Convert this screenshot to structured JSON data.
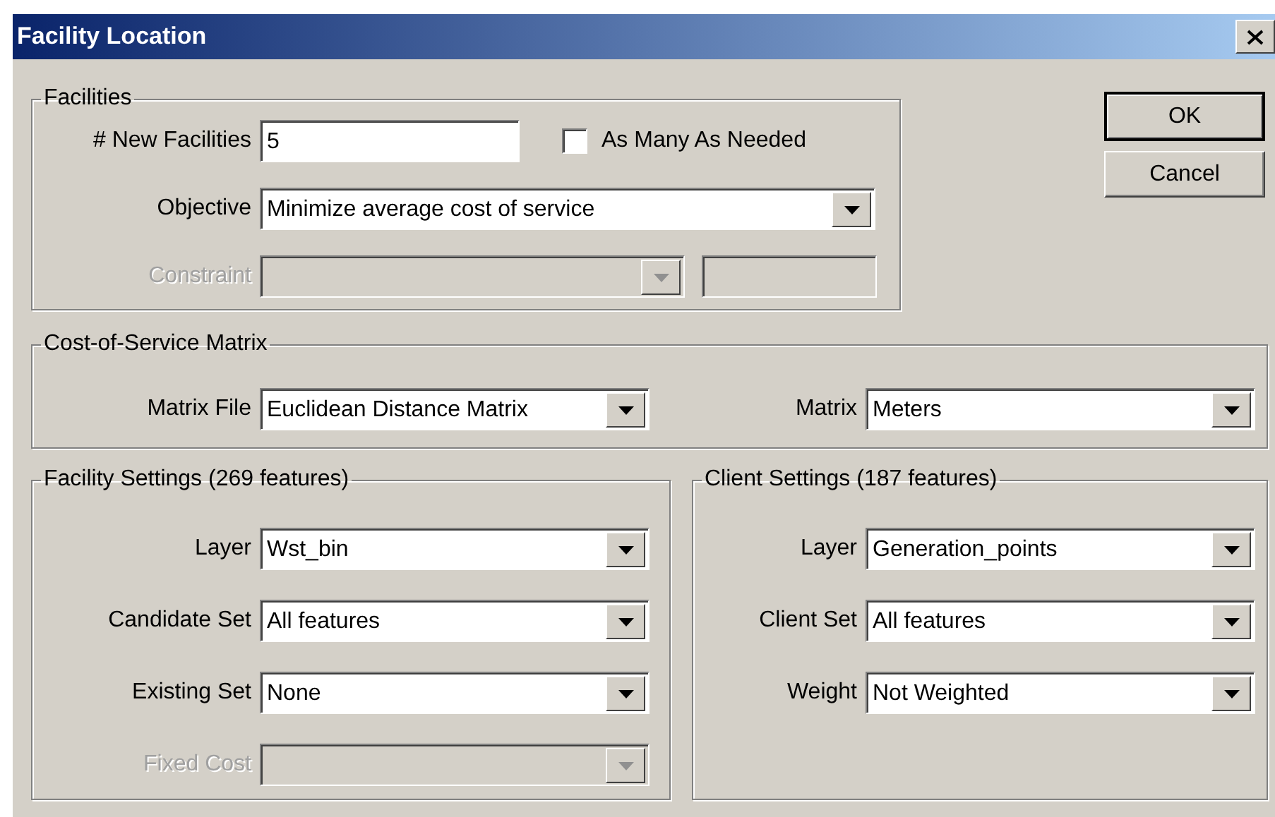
{
  "window": {
    "title": "Facility Location"
  },
  "buttons": [
    {
      "label": "OK",
      "default": true
    },
    {
      "label": "Cancel",
      "default": false
    }
  ],
  "facilities": {
    "legend": "Facilities",
    "new_facilities": {
      "label": "# New Facilities",
      "value": "5"
    },
    "as_many_as_needed": {
      "label": "As Many As Needed",
      "checked": false
    },
    "objective": {
      "label": "Objective",
      "value": "Minimize average cost of service",
      "disabled": false
    },
    "constraint": {
      "label": "Constraint",
      "disabled": true
    }
  },
  "cost_matrix": {
    "legend": "Cost-of-Service Matrix",
    "matrix_file": {
      "label": "Matrix File",
      "value": "Euclidean Distance Matrix",
      "disabled": false
    },
    "matrix": {
      "label": "Matrix",
      "value": "Meters",
      "disabled": false
    }
  },
  "facility_settings": {
    "legend": "Facility Settings (269 features)",
    "fields": [
      {
        "label": "Layer",
        "value": "Wst_bin",
        "disabled": false
      },
      {
        "label": "Candidate Set",
        "value": "All features",
        "disabled": false
      },
      {
        "label": "Existing Set",
        "value": "None",
        "disabled": false
      },
      {
        "label": "Fixed Cost",
        "disabled": true
      }
    ]
  },
  "client_settings": {
    "legend": "Client Settings (187 features)",
    "fields": [
      {
        "label": "Layer",
        "value": "Generation_points",
        "disabled": false
      },
      {
        "label": "Client Set",
        "value": "All features",
        "disabled": false
      },
      {
        "label": "Weight",
        "value": "Not Weighted",
        "disabled": false
      }
    ]
  }
}
